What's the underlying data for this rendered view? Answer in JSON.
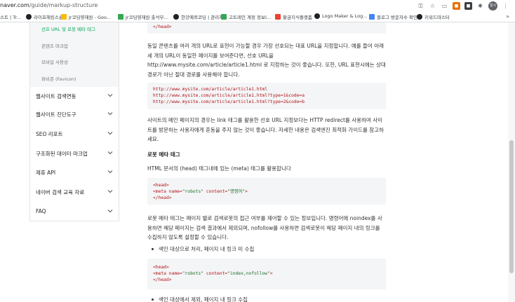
{
  "browser": {
    "url_host": "naver.com",
    "url_path": "/guide/markup-structure",
    "bookmarks": [
      {
        "label": "스트 | Tr...",
        "icon": "generic"
      },
      {
        "label": "라이프해킹스쿨",
        "icon": "dark"
      },
      {
        "label": "Jr코딩영재원 - Goo...",
        "icon": "yellow"
      },
      {
        "label": "Jr코딩영재원 출석부...",
        "icon": "green"
      },
      {
        "label": "한강예뢰코딩 | 관리자",
        "icon": "dark"
      },
      {
        "label": "고트레인 계정 정보(...",
        "icon": "green"
      },
      {
        "label": "황금지식플랫폼",
        "icon": "red"
      },
      {
        "label": "Logo Maker & Log...",
        "icon": "dark"
      },
      {
        "label": "블로그 방문자수 확인",
        "icon": "blue"
      },
      {
        "label": "키워드마스터",
        "icon": "dark"
      }
    ],
    "profile_label": "일시중"
  },
  "sidebar": {
    "sub_items": [
      {
        "label": "선호 URL 및 로봇 메타 태그",
        "active": true
      },
      {
        "label": "콘텐츠 마크업",
        "active": false
      },
      {
        "label": "모바일 사용성",
        "active": false
      },
      {
        "label": "파비콘 (Favicon)",
        "active": false
      }
    ],
    "menu": [
      {
        "label": "웹사이트 검색연동"
      },
      {
        "label": "웹사이트 진단도구"
      },
      {
        "label": "SEO 리포트"
      },
      {
        "label": "구조화된 데이터 마크업"
      },
      {
        "label": "제휴 API"
      },
      {
        "label": "네이버 검색 교육 자료"
      },
      {
        "label": "FAQ"
      }
    ]
  },
  "content": {
    "code_top_line": "</head>",
    "para1": "동일 콘텐츠를 여러 개의 URL로 표현이 가능할 경우 가장 선호되는 대표 URL을 지정합니다. 예를 들어 아래 세 개의 URL이 동일한 페이지를 보여준다면, 선호 URL을 http://www.mysite.com/article/article1.html 로 지정하는 것이 좋습니다. 또한, URL 표현시에는 상대 경로가 아닌 절대 경로를 사용해야 합니다.",
    "urls": [
      "http://www.mysite.com/article/article1.html",
      "http://www.mysite.com/article/article1.html?type=1&code=a",
      "http://www.mysite.com/article/article1.html?type=2&code=b"
    ],
    "para2": "사이트의 메인 페이지의 경우는 link 태그를 활용한 선호 URL 지정보다는 HTTP redirect를 사용하여 사이트를 방문하는 사용자에게 혼동을 주지 않는 것이 좋습니다. 자세한 내용은 검색엔진 최적화 가이드를 참고하세요.",
    "section_title": "로봇 메타 태그",
    "para3": "HTML 문서의 (head) 태그내에 있는 (meta) 태그를 활용합니다",
    "code1": {
      "open": "<head>",
      "meta_open": "<meta ",
      "name_attr": "name=",
      "name_val": "\"robots\"",
      "content_attr": " content=",
      "content_val": "\"명령어\"",
      "meta_close": ">",
      "close": "</head>"
    },
    "para4": "로봇 메타 태그는 페이지 별로 검색로봇의 접근 여부를 제어할 수 있는 정보입니다. 명령어에 noindex를 사용하면 해당 페이지는 검색 결과에서 제외되며, nofollow를 사용하면 검색로봇이 해당 페이지 내의 링크를 수집하지 않도록 설정할 수 있습니다.",
    "bullet1": "색인 대상으로 처리, 페이지 내 링크 미 수집",
    "code2": {
      "open": "<head>",
      "meta_open": "<meta ",
      "name_attr": "name=",
      "name_val": "\"robots\"",
      "content_attr": " content=",
      "content_val": "\"index,nofollow\"",
      "meta_close": ">",
      "close": "</head>"
    },
    "bullet2": "색인 대상에서 제외, 페이지 내 링크 수집"
  },
  "colors": {
    "accent": "#00a85a",
    "code_tag": "#b0141b",
    "code_value": "#1a6b2b",
    "code_bg": "#f4f5f6"
  }
}
